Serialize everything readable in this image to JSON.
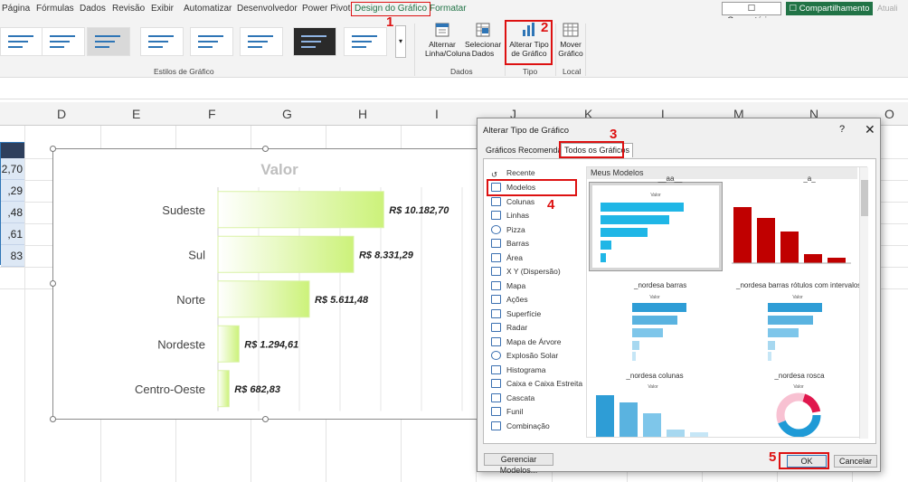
{
  "ribbon_tabs": [
    "Página",
    "Fórmulas",
    "Dados",
    "Revisão",
    "Exibir",
    "Automatizar",
    "Desenvolvedor",
    "Power Pivot",
    "Design do Gráfico",
    "Formatar"
  ],
  "header_buttons": {
    "comments": "Comentários",
    "share": "Compartilhamento",
    "update": "Atuali"
  },
  "ribbon": {
    "styles_group": "Estilos de Gráfico",
    "switch_row_col": [
      "Alternar",
      "Linha/Coluna"
    ],
    "select_data": [
      "Selecionar",
      "Dados"
    ],
    "data_group": "Dados",
    "change_type": [
      "Alterar Tipo",
      "de Gráfico"
    ],
    "type_group": "Tipo",
    "move_chart": [
      "Mover",
      "Gráfico"
    ],
    "location_group": "Local"
  },
  "step_numbers": [
    "1",
    "2",
    "3",
    "4",
    "5"
  ],
  "columns": [
    "D",
    "E",
    "F",
    "G",
    "H",
    "I",
    "J",
    "K",
    "L",
    "M",
    "N",
    "O"
  ],
  "selected_cells": [
    "2,70",
    ",29",
    ",48",
    ",61",
    "83"
  ],
  "chart_data": {
    "type": "bar",
    "title": "Valor",
    "categories": [
      "Sudeste",
      "Sul",
      "Norte",
      "Nordeste",
      "Centro-Oeste"
    ],
    "values": [
      10182.7,
      8331.29,
      5611.48,
      1294.61,
      682.83
    ],
    "labels": [
      "R$ 10.182,70",
      "R$ 8.331,29",
      "R$ 5.611,48",
      "R$ 1.294,61",
      "R$ 682,83"
    ],
    "xlim": [
      0,
      15000
    ],
    "grid": true,
    "bar_color": "#ccf27a"
  },
  "dialog": {
    "title": "Alterar Tipo de Gráfico",
    "help": "?",
    "close": "✕",
    "tabs": [
      "Gráficos Recomendados",
      "Todos os Gráficos"
    ],
    "categories": [
      "Recente",
      "Modelos",
      "Colunas",
      "Linhas",
      "Pizza",
      "Barras",
      "Área",
      "X Y (Dispersão)",
      "Mapa",
      "Ações",
      "Superfície",
      "Radar",
      "Mapa de Árvore",
      "Explosão Solar",
      "Histograma",
      "Caixa e Caixa Estreita",
      "Cascata",
      "Funil",
      "Combinação"
    ],
    "section": "Meus Modelos",
    "templates": [
      "__aa__",
      "_a_",
      "_nordesa barras",
      "_nordesa barras rótulos com intervalos",
      "_nordesa colunas",
      "_nordesa rosca"
    ],
    "thumb_label": "Valor",
    "manage": "Gerenciar Modelos...",
    "ok": "OK",
    "cancel": "Cancelar"
  }
}
